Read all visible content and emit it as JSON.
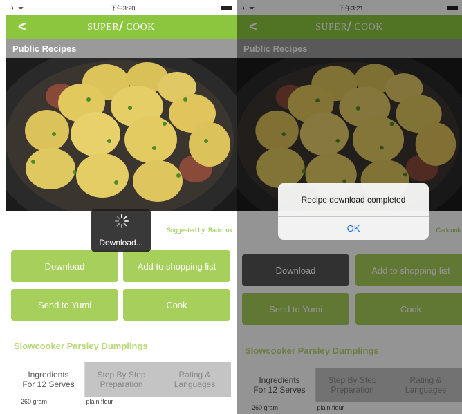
{
  "left": {
    "status": {
      "signal": "✈ ᯤ",
      "time": "下午3:20"
    },
    "nav": {
      "back": "<",
      "brand_left": "SUPER",
      "brand_right": "COOK"
    },
    "section_title": "Public Recipes",
    "suggested_by": "Suggested by: Badcook",
    "loading_text": "Download...",
    "buttons": {
      "download": "Download",
      "shopping": "Add to shopping list",
      "yumi": "Send to Yumi",
      "cook": "Cook"
    },
    "recipe_title": "Slowcooker Parsley Dumplings",
    "tabs": {
      "ingredients_1": "Ingredients",
      "ingredients_2": "For 12 Serves",
      "steps_1": "Step By Step",
      "steps_2": "Preparation",
      "rating_1": "Rating &",
      "rating_2": "Languages"
    },
    "ingredient": {
      "qty": "260 gram",
      "name": "plain flour"
    }
  },
  "right": {
    "status": {
      "signal": "✈ ᯤ",
      "time": "下午3:21"
    },
    "nav": {
      "back": "<",
      "brand_left": "SUPER",
      "brand_right": "COOK"
    },
    "section_title": "Public Recipes",
    "suggested_by": "Cadcook",
    "alert": {
      "message": "Recipe download completed",
      "ok": "OK"
    },
    "buttons": {
      "download": "Download",
      "shopping": "Add to shopping list",
      "yumi": "Send to Yumi",
      "cook": "Cook"
    },
    "recipe_title": "Slowcooker Parsley Dumplings",
    "tabs": {
      "ingredients_1": "Ingredients",
      "ingredients_2": "For 12 Serves",
      "steps_1": "Step By Step",
      "steps_2": "Preparation",
      "rating_1": "Rating &",
      "rating_2": "Languages"
    },
    "ingredient": {
      "qty": "260 gram",
      "name": "plain flour"
    }
  },
  "colors": {
    "accent": "#8cc63f",
    "button": "#a7cf5b",
    "pressed_button": "#555555",
    "title_bar": "#9a9a9a",
    "link_blue": "#1a6fd8"
  }
}
